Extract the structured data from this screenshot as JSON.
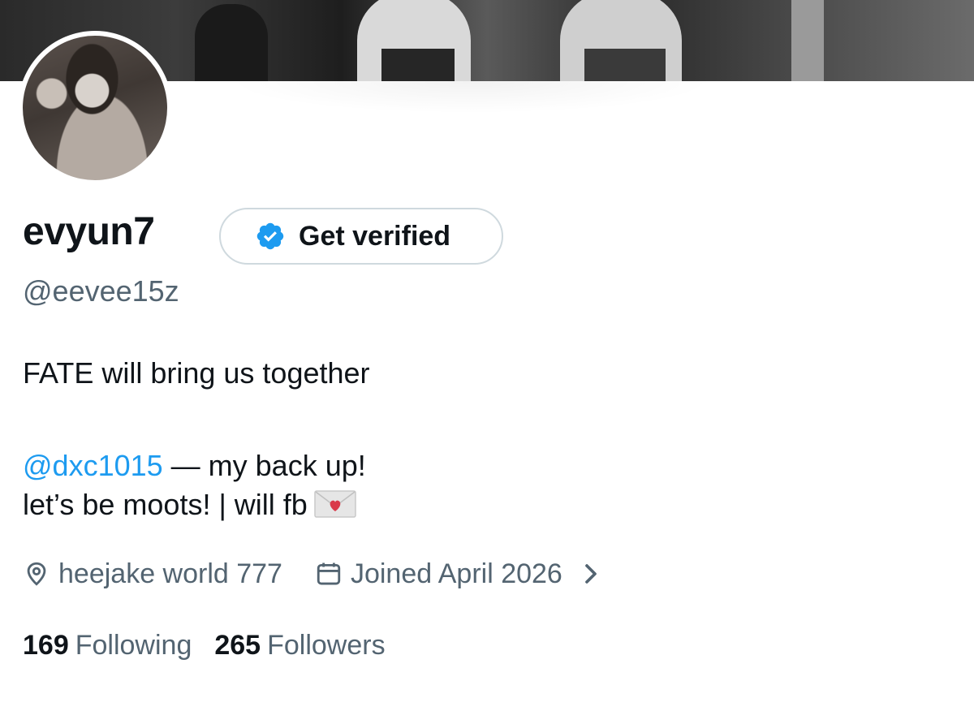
{
  "profile": {
    "display_name": "evyun7",
    "handle": "@eevee15z",
    "verify_button_label": "Get verified",
    "bio": {
      "line1": "FATE will bring us together",
      "mention": "@dxc1015",
      "line2_rest": " — my back up!",
      "line3": "let’s be moots! | will fb"
    },
    "location": "heejake world 777",
    "joined": "Joined April 2026",
    "following_count": "169",
    "following_label": "Following",
    "followers_count": "265",
    "followers_label": "Followers"
  },
  "icons": {
    "verified": "verified-badge-icon",
    "location": "location-pin-icon",
    "calendar": "calendar-icon",
    "chevron": "chevron-right-icon",
    "letter": "love-letter-emoji-icon"
  },
  "colors": {
    "accent": "#1d9bf0",
    "secondary_text": "#536471",
    "primary_text": "#0f1419"
  }
}
